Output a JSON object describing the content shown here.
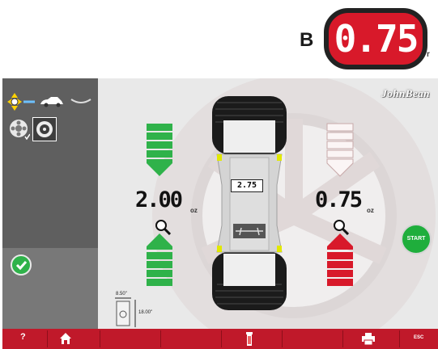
{
  "callout": {
    "letter": "B",
    "value": "0.75"
  },
  "screen": {
    "brand": "JohnBean",
    "left": {
      "value": "2.00",
      "unit": "oz"
    },
    "right": {
      "value": "0.75",
      "unit": "oz"
    },
    "tire_value": "2.75",
    "start_label": "START",
    "dimension_width": "8.50\"",
    "dimension_height": "18.00\""
  },
  "toolbar": {
    "help_label": "?",
    "esc_label": "ESC"
  },
  "colors": {
    "accent_red": "#c0192a",
    "green": "#2fb24a",
    "sidebar": "#6d6d6d"
  }
}
